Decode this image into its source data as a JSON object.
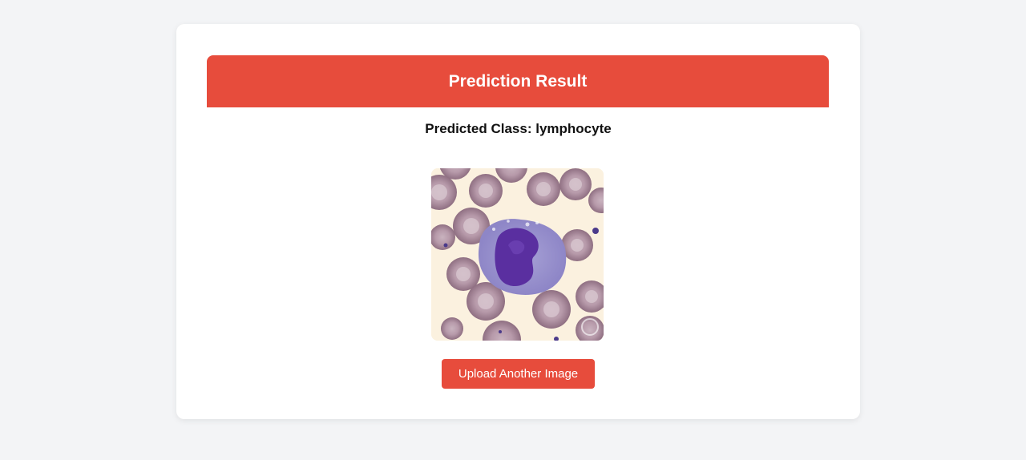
{
  "header": {
    "title": "Prediction Result"
  },
  "result": {
    "label_prefix": "Predicted Class: ",
    "predicted_class": "lymphocyte",
    "full_text": "Predicted Class: lymphocyte"
  },
  "image": {
    "subject": "blood-smear-cell-image"
  },
  "actions": {
    "upload_label": "Upload Another Image"
  },
  "colors": {
    "accent": "#e74c3c",
    "page_background": "#f3f4f6",
    "card_background": "#ffffff"
  }
}
